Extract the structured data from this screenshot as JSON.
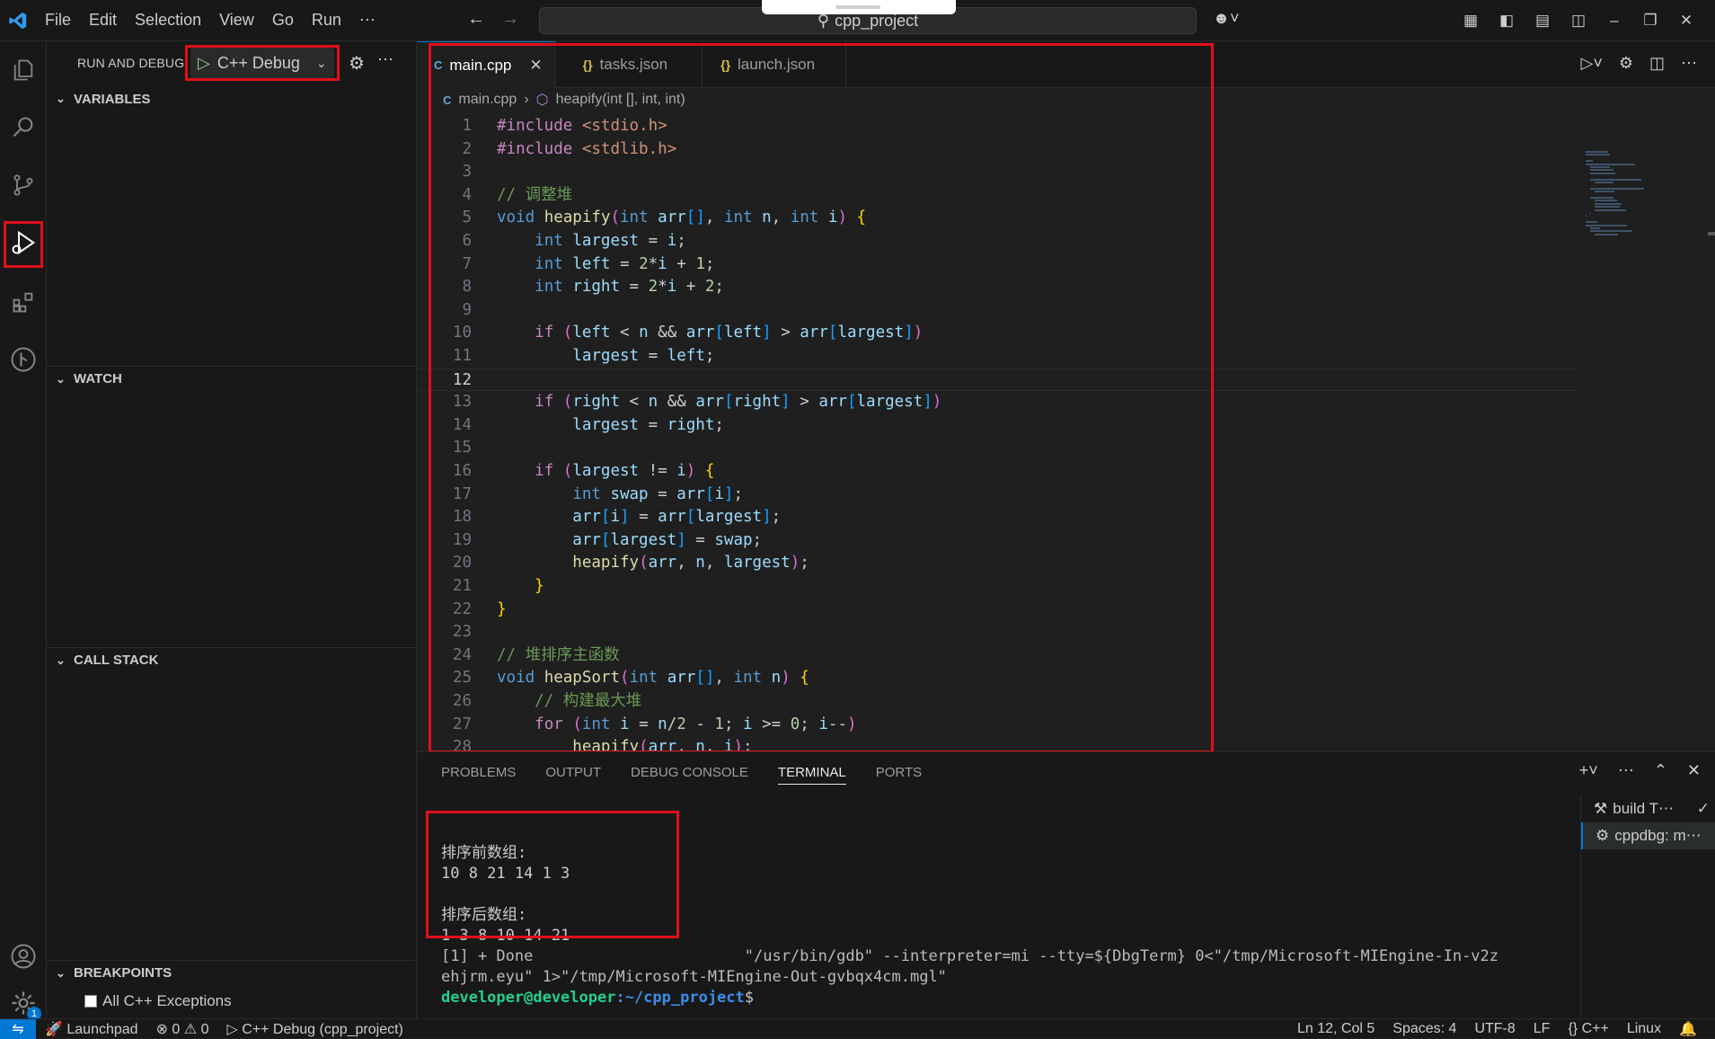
{
  "window": {
    "title": "cpp_project"
  },
  "menu": [
    "File",
    "Edit",
    "Selection",
    "View",
    "Go",
    "Run",
    "⋯"
  ],
  "sidebar": {
    "header": "RUN AND DEBUG",
    "config": "C++ Debug",
    "sections": {
      "variables": "VARIABLES",
      "watch": "WATCH",
      "call_stack": "CALL STACK",
      "breakpoints": "BREAKPOINTS"
    },
    "exceptions_label": "All C++ Exceptions"
  },
  "tabs": [
    {
      "label": "main.cpp"
    },
    {
      "label": "tasks.json"
    },
    {
      "label": "launch.json"
    }
  ],
  "breadcrumb": {
    "file": "main.cpp",
    "symbol": "heapify(int [], int, int)"
  },
  "code_lines": [
    {
      "n": "1",
      "text": "#include <stdio.h>"
    },
    {
      "n": "2",
      "text": "#include <stdlib.h>"
    },
    {
      "n": "3",
      "text": ""
    },
    {
      "n": "4",
      "text": "// 调整堆"
    },
    {
      "n": "5",
      "text": "void heapify(int arr[], int n, int i) {"
    },
    {
      "n": "6",
      "text": "    int largest = i;"
    },
    {
      "n": "7",
      "text": "    int left = 2*i + 1;"
    },
    {
      "n": "8",
      "text": "    int right = 2*i + 2;"
    },
    {
      "n": "9",
      "text": ""
    },
    {
      "n": "10",
      "text": "    if (left < n && arr[left] > arr[largest])"
    },
    {
      "n": "11",
      "text": "        largest = left;"
    },
    {
      "n": "12",
      "text": ""
    },
    {
      "n": "13",
      "text": "    if (right < n && arr[right] > arr[largest])"
    },
    {
      "n": "14",
      "text": "        largest = right;"
    },
    {
      "n": "15",
      "text": ""
    },
    {
      "n": "16",
      "text": "    if (largest != i) {"
    },
    {
      "n": "17",
      "text": "        int swap = arr[i];"
    },
    {
      "n": "18",
      "text": "        arr[i] = arr[largest];"
    },
    {
      "n": "19",
      "text": "        arr[largest] = swap;"
    },
    {
      "n": "20",
      "text": "        heapify(arr, n, largest);"
    },
    {
      "n": "21",
      "text": "    }"
    },
    {
      "n": "22",
      "text": "}"
    },
    {
      "n": "23",
      "text": ""
    },
    {
      "n": "24",
      "text": "// 堆排序主函数"
    },
    {
      "n": "25",
      "text": "void heapSort(int arr[], int n) {"
    },
    {
      "n": "26",
      "text": "    // 构建最大堆"
    },
    {
      "n": "27",
      "text": "    for (int i = n/2 - 1; i >= 0; i--)"
    },
    {
      "n": "28",
      "text": "        heapify(arr, n, i);"
    }
  ],
  "panel": {
    "tabs": [
      "PROBLEMS",
      "OUTPUT",
      "DEBUG CONSOLE",
      "TERMINAL",
      "PORTS"
    ],
    "terminal_lines": [
      "",
      "排序前数组:",
      "10 8 21 14 1 3",
      "",
      "排序后数组:",
      "1 3 8 10 14 21",
      "[1] + Done                       \"/usr/bin/gdb\" --interpreter=mi --tty=${DbgTerm} 0<\"/tmp/Microsoft-MIEngine-In-v2z",
      "ehjrm.eyu\" 1>\"/tmp/Microsoft-MIEngine-Out-gvbqx4cm.mgl\""
    ],
    "prompt_user": "developer@developer",
    "prompt_path": ":~/cpp_project",
    "prompt_sign": "$",
    "terminals": [
      "build T⋯",
      "cppdbg: m⋯"
    ]
  },
  "statusbar": {
    "launchpad": "Launchpad",
    "errors": "0",
    "warnings": "0",
    "debug": "C++ Debug (cpp_project)",
    "position": "Ln 12, Col 5",
    "spaces": "Spaces: 4",
    "encoding": "UTF-8",
    "eol": "LF",
    "language": "C++",
    "os": "Linux"
  },
  "badges": {
    "accounts_gear": "1"
  }
}
